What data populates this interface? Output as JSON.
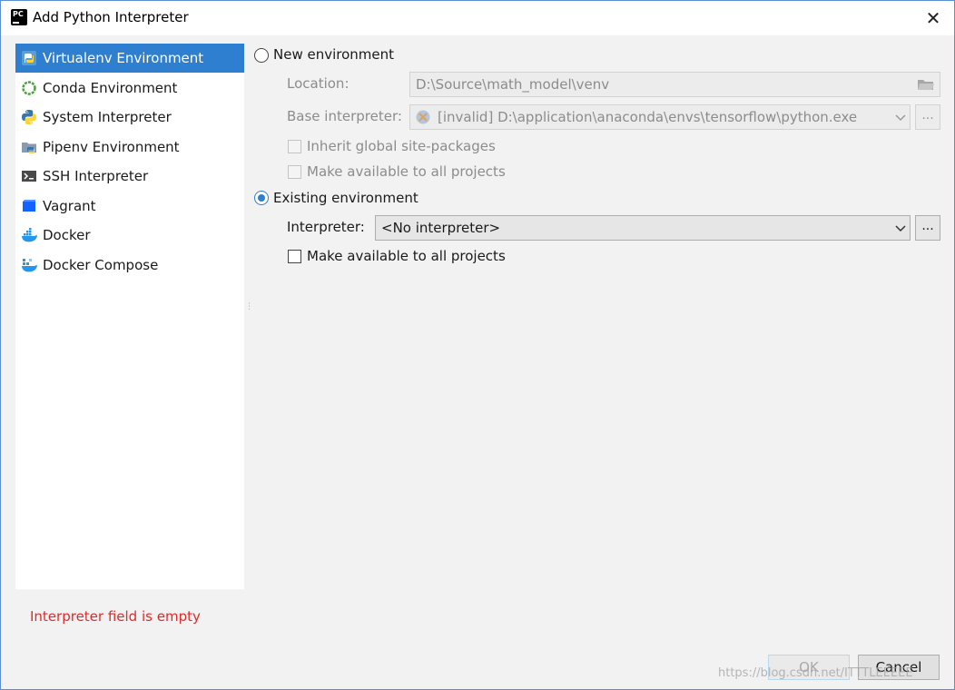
{
  "window": {
    "title": "Add Python Interpreter",
    "close_symbol": "✕"
  },
  "sidebar": {
    "items": [
      {
        "label": "Virtualenv Environment",
        "icon": "virtualenv-icon",
        "selected": true
      },
      {
        "label": "Conda Environment",
        "icon": "conda-icon",
        "selected": false
      },
      {
        "label": "System Interpreter",
        "icon": "python-icon",
        "selected": false
      },
      {
        "label": "Pipenv Environment",
        "icon": "pipenv-icon",
        "selected": false
      },
      {
        "label": "SSH Interpreter",
        "icon": "terminal-icon",
        "selected": false
      },
      {
        "label": "Vagrant",
        "icon": "vagrant-icon",
        "selected": false
      },
      {
        "label": "Docker",
        "icon": "docker-icon",
        "selected": false
      },
      {
        "label": "Docker Compose",
        "icon": "docker-compose-icon",
        "selected": false
      }
    ],
    "splitter_glyph": "⋮"
  },
  "new_env": {
    "radio_label": "New environment",
    "location_label": "Location:",
    "location_value": "D:\\Source\\math_model\\venv",
    "base_label": "Base interpreter:",
    "base_value": "[invalid] D:\\application\\anaconda\\envs\\tensorflow\\python.exe",
    "browse_label": "...",
    "inherit_label": "Inherit global site-packages",
    "make_available_label": "Make available to all projects"
  },
  "existing_env": {
    "radio_label": "Existing environment",
    "interpreter_label": "Interpreter:",
    "interpreter_value": "<No interpreter>",
    "browse_label": "...",
    "make_available_label": "Make available to all projects"
  },
  "error_text": "Interpreter field is empty",
  "buttons": {
    "ok": "OK",
    "cancel": "Cancel"
  },
  "watermark": "https://blog.csdn.net/ITTTLEEEEE",
  "colors": {
    "accent": "#2f7fd1",
    "error": "#e22a2a"
  }
}
